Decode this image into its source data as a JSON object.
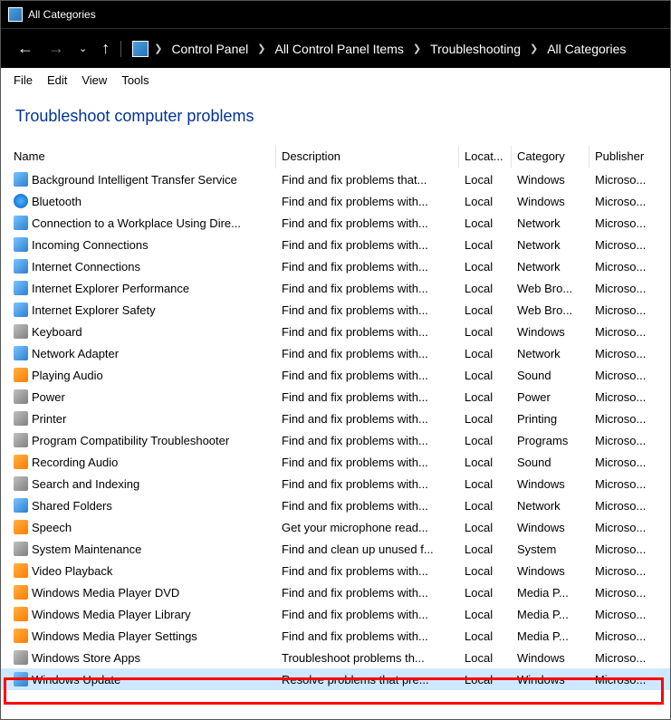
{
  "window": {
    "title": "All Categories"
  },
  "breadcrumb": {
    "items": [
      "Control Panel",
      "All Control Panel Items",
      "Troubleshooting",
      "All Categories"
    ]
  },
  "menu": {
    "file": "File",
    "edit": "Edit",
    "view": "View",
    "tools": "Tools"
  },
  "page": {
    "heading": "Troubleshoot computer problems"
  },
  "columns": {
    "c0": "Name",
    "c1": "Description",
    "c2": "Locat...",
    "c3": "Category",
    "c4": "Publisher"
  },
  "rows": [
    {
      "name": "Background Intelligent Transfer Service",
      "desc": "Find and fix problems that...",
      "loc": "Local",
      "cat": "Windows",
      "pub": "Microso...",
      "icon": "net"
    },
    {
      "name": "Bluetooth",
      "desc": "Find and fix problems with...",
      "loc": "Local",
      "cat": "Windows",
      "pub": "Microso...",
      "icon": "blue"
    },
    {
      "name": "Connection to a Workplace Using Dire...",
      "desc": "Find and fix problems with...",
      "loc": "Local",
      "cat": "Network",
      "pub": "Microso...",
      "icon": "net"
    },
    {
      "name": "Incoming Connections",
      "desc": "Find and fix problems with...",
      "loc": "Local",
      "cat": "Network",
      "pub": "Microso...",
      "icon": "net"
    },
    {
      "name": "Internet Connections",
      "desc": "Find and fix problems with...",
      "loc": "Local",
      "cat": "Network",
      "pub": "Microso...",
      "icon": "net"
    },
    {
      "name": "Internet Explorer Performance",
      "desc": "Find and fix problems with...",
      "loc": "Local",
      "cat": "Web Bro...",
      "pub": "Microso...",
      "icon": "net"
    },
    {
      "name": "Internet Explorer Safety",
      "desc": "Find and fix problems with...",
      "loc": "Local",
      "cat": "Web Bro...",
      "pub": "Microso...",
      "icon": "net"
    },
    {
      "name": "Keyboard",
      "desc": "Find and fix problems with...",
      "loc": "Local",
      "cat": "Windows",
      "pub": "Microso...",
      "icon": "sys"
    },
    {
      "name": "Network Adapter",
      "desc": "Find and fix problems with...",
      "loc": "Local",
      "cat": "Network",
      "pub": "Microso...",
      "icon": "net"
    },
    {
      "name": "Playing Audio",
      "desc": "Find and fix problems with...",
      "loc": "Local",
      "cat": "Sound",
      "pub": "Microso...",
      "icon": "media"
    },
    {
      "name": "Power",
      "desc": "Find and fix problems with...",
      "loc": "Local",
      "cat": "Power",
      "pub": "Microso...",
      "icon": "sys"
    },
    {
      "name": "Printer",
      "desc": "Find and fix problems with...",
      "loc": "Local",
      "cat": "Printing",
      "pub": "Microso...",
      "icon": "sys"
    },
    {
      "name": "Program Compatibility Troubleshooter",
      "desc": "Find and fix problems with...",
      "loc": "Local",
      "cat": "Programs",
      "pub": "Microso...",
      "icon": "sys"
    },
    {
      "name": "Recording Audio",
      "desc": "Find and fix problems with...",
      "loc": "Local",
      "cat": "Sound",
      "pub": "Microso...",
      "icon": "media"
    },
    {
      "name": "Search and Indexing",
      "desc": "Find and fix problems with...",
      "loc": "Local",
      "cat": "Windows",
      "pub": "Microso...",
      "icon": "sys"
    },
    {
      "name": "Shared Folders",
      "desc": "Find and fix problems with...",
      "loc": "Local",
      "cat": "Network",
      "pub": "Microso...",
      "icon": "net"
    },
    {
      "name": "Speech",
      "desc": "Get your microphone read...",
      "loc": "Local",
      "cat": "Windows",
      "pub": "Microso...",
      "icon": "media"
    },
    {
      "name": "System Maintenance",
      "desc": "Find and clean up unused f...",
      "loc": "Local",
      "cat": "System",
      "pub": "Microso...",
      "icon": "sys"
    },
    {
      "name": "Video Playback",
      "desc": "Find and fix problems with...",
      "loc": "Local",
      "cat": "Windows",
      "pub": "Microso...",
      "icon": "media"
    },
    {
      "name": "Windows Media Player DVD",
      "desc": "Find and fix problems with...",
      "loc": "Local",
      "cat": "Media P...",
      "pub": "Microso...",
      "icon": "media"
    },
    {
      "name": "Windows Media Player Library",
      "desc": "Find and fix problems with...",
      "loc": "Local",
      "cat": "Media P...",
      "pub": "Microso...",
      "icon": "media"
    },
    {
      "name": "Windows Media Player Settings",
      "desc": "Find and fix problems with...",
      "loc": "Local",
      "cat": "Media P...",
      "pub": "Microso...",
      "icon": "media"
    },
    {
      "name": "Windows Store Apps",
      "desc": "Troubleshoot problems th...",
      "loc": "Local",
      "cat": "Windows",
      "pub": "Microso...",
      "icon": "sys"
    },
    {
      "name": "Windows Update",
      "desc": "Resolve problems that pre...",
      "loc": "Local",
      "cat": "Windows",
      "pub": "Microso...",
      "icon": "net",
      "selected": true
    }
  ]
}
